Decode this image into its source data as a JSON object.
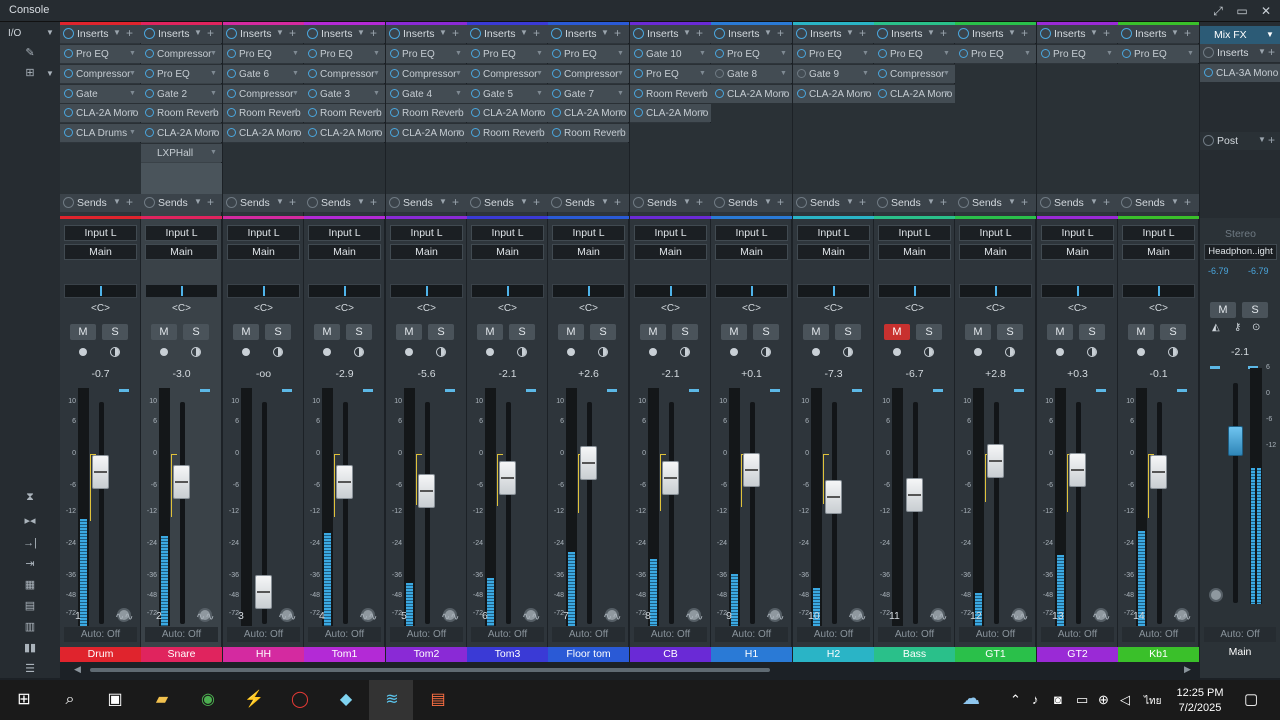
{
  "window": {
    "title": "Console",
    "ctrl_min": "⤢",
    "ctrl_max": "▭",
    "ctrl_close": "✕"
  },
  "leftbar": {
    "io": "I/O"
  },
  "labels": {
    "inserts": "Inserts",
    "sends": "Sends",
    "pan": "<C>",
    "mute": "M",
    "solo": "S",
    "auto": "Auto: Off"
  },
  "colors": {
    "accent": "#4aa6dd",
    "mute_on": "#c8312f"
  },
  "scale_ticks": [
    "10",
    "6",
    "0",
    "-6",
    "-12",
    "-24",
    "-36",
    "-48",
    "-72"
  ],
  "channels": [
    {
      "num": "1",
      "name": "Drum",
      "color": "#e0242d",
      "input": "Input L",
      "output": "Main",
      "vol": "-0.7",
      "fader": 0.71,
      "meter": 0.45,
      "pan": 0.5,
      "inserts": [
        "Pro EQ",
        "Compressor",
        "Gate",
        "CLA-2A Mono",
        "CLA Drums"
      ],
      "mute": false,
      "selected": false
    },
    {
      "num": "2",
      "name": "Snare",
      "color": "#e0245e",
      "input": "Input L",
      "output": "Main",
      "vol": "-3.0",
      "fader": 0.66,
      "meter": 0.38,
      "pan": 0.5,
      "inserts": [
        "Compressor",
        "Pro EQ",
        "Gate 2",
        "Room Reverb",
        "CLA-2A Mono",
        "LXPHall"
      ],
      "mute": false,
      "selected": true
    },
    {
      "num": "3",
      "name": "HH",
      "color": "#d42aa0",
      "input": "Input L",
      "output": "Main",
      "vol": "-oo",
      "fader": 0.08,
      "meter": 0.0,
      "pan": 0.5,
      "inserts": [
        "Pro EQ",
        "Gate 6",
        "Compressor",
        "Room Reverb",
        "CLA-2A Mono"
      ],
      "mute": false,
      "selected": false
    },
    {
      "num": "4",
      "name": "Tom1",
      "color": "#b32ad6",
      "input": "Input L",
      "output": "Main",
      "vol": "-2.9",
      "fader": 0.66,
      "meter": 0.39,
      "pan": 0.5,
      "inserts": [
        "Pro EQ",
        "Compressor",
        "Gate 3",
        "Room Reverb",
        "CLA-2A Mono"
      ],
      "mute": false,
      "selected": false
    },
    {
      "num": "5",
      "name": "Tom2",
      "color": "#8a2ad6",
      "input": "Input L",
      "output": "Main",
      "vol": "-5.6",
      "fader": 0.61,
      "meter": 0.18,
      "pan": 0.5,
      "inserts": [
        "Pro EQ",
        "Compressor",
        "Gate 4",
        "Room Reverb",
        "CLA-2A Mono"
      ],
      "mute": false,
      "selected": false
    },
    {
      "num": "6",
      "name": "Tom3",
      "color": "#3a3ad6",
      "input": "Input L",
      "output": "Main",
      "vol": "-2.1",
      "fader": 0.68,
      "meter": 0.2,
      "pan": 0.5,
      "inserts": [
        "Pro EQ",
        "Compressor",
        "Gate 5",
        "CLA-2A Mono",
        "Room Reverb"
      ],
      "mute": false,
      "selected": false
    },
    {
      "num": "7",
      "name": "Floor tom",
      "color": "#2a5ad6",
      "input": "Input L",
      "output": "Main",
      "vol": "+2.6",
      "fader": 0.76,
      "meter": 0.31,
      "pan": 0.5,
      "inserts": [
        "Pro EQ",
        "Compressor",
        "Gate 7",
        "CLA-2A Mono",
        "Room Reverb"
      ],
      "mute": false,
      "selected": false
    },
    {
      "num": "8",
      "name": "CB",
      "color": "#6a2ad6",
      "input": "Input L",
      "output": "Main",
      "vol": "-2.1",
      "fader": 0.68,
      "meter": 0.28,
      "pan": 0.5,
      "inserts": [
        "Gate 10",
        "Pro EQ",
        "Room Reverb",
        "CLA-2A Mono"
      ],
      "mute": false,
      "selected": false
    },
    {
      "num": "9",
      "name": "H1",
      "color": "#2a7ad6",
      "input": "Input L",
      "output": "Main",
      "vol": "+0.1",
      "fader": 0.72,
      "meter": 0.22,
      "pan": 0.5,
      "inserts": [
        "Pro EQ",
        "Gate 8",
        "CLA-2A Mono"
      ],
      "mute": false,
      "selected": false,
      "off": [
        1
      ]
    },
    {
      "num": "10",
      "name": "H2",
      "color": "#2ab4c6",
      "input": "Input L",
      "output": "Main",
      "vol": "-7.3",
      "fader": 0.58,
      "meter": 0.16,
      "pan": 0.5,
      "inserts": [
        "Pro EQ",
        "Gate 9",
        "CLA-2A Mono"
      ],
      "mute": false,
      "selected": false,
      "off": [
        1
      ]
    },
    {
      "num": "11",
      "name": "Bass",
      "color": "#2ac08a",
      "input": "Input L",
      "output": "Main",
      "vol": "-6.7",
      "fader": 0.59,
      "meter": 0.0,
      "pan": 0.5,
      "inserts": [
        "Pro EQ",
        "Compressor",
        "CLA-2A Mono"
      ],
      "mute": true,
      "selected": false
    },
    {
      "num": "12",
      "name": "GT1",
      "color": "#2ac04a",
      "input": "Input L",
      "output": "Main",
      "vol": "+2.8",
      "fader": 0.77,
      "meter": 0.14,
      "pan": 0.5,
      "inserts": [
        "Pro EQ"
      ],
      "mute": false,
      "selected": false
    },
    {
      "num": "13",
      "name": "GT2",
      "color": "#9a2ad6",
      "input": "Input L",
      "output": "Main",
      "vol": "+0.3",
      "fader": 0.72,
      "meter": 0.3,
      "pan": 0.5,
      "inserts": [
        "Pro EQ"
      ],
      "mute": false,
      "selected": false
    },
    {
      "num": "14",
      "name": "Kb1",
      "color": "#3ac02a",
      "input": "Input L",
      "output": "Main",
      "vol": "-0.1",
      "fader": 0.71,
      "meter": 0.4,
      "pan": 0.5,
      "inserts": [
        "Pro EQ"
      ],
      "mute": false,
      "selected": false
    }
  ],
  "fx": {
    "title": "Mix FX",
    "inserts": "Inserts",
    "insert_item": "CLA-3A Mono",
    "post": "Post"
  },
  "main": {
    "stereo": "Stereo",
    "output": "Headphon..ight",
    "left_val": "-6.79",
    "right_val": "-6.79",
    "vol": "-2.1",
    "name": "Main",
    "auto": "Auto: Off"
  },
  "taskbar": {
    "time": "12:25 PM",
    "date": "7/2/2025",
    "lang": "ไทย"
  }
}
